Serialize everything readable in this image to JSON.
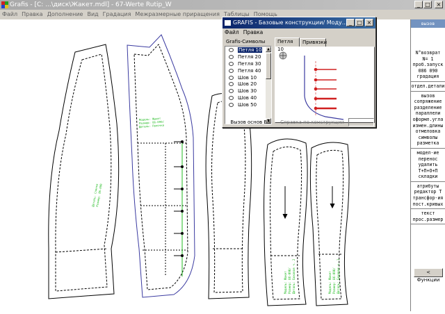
{
  "window": {
    "title": "Grafis - [C: ...\\диск\\Жакет.mdl] - 67-Werte Rutip_W",
    "minimize": "_",
    "maximize": "□",
    "close": "×"
  },
  "menubar": {
    "items": [
      "Файл",
      "Правка",
      "Дополнение",
      "Вид",
      "Градация",
      "Межразмерные приращения",
      "Таблицы",
      "Помощь"
    ]
  },
  "right_panel": {
    "header": "вызов",
    "groups": [
      [
        "N°возврат",
        "N=  1",
        "проб.запуск",
        "086 090",
        "градация"
      ],
      [
        "отдел.детали"
      ],
      [
        "вызов",
        "сопряжение",
        "разделение",
        "параллели",
        "оформл.угла",
        "измен.длины",
        "отмеловка",
        "символы",
        "разметка"
      ],
      [
        "модел-ие",
        "перенос",
        "удалить",
        "Т+П+О+П",
        "складки"
      ],
      [
        "атрибуты",
        "редактор Т",
        "трансфор-ия",
        "пост.кривых"
      ],
      [
        "текст",
        "прос.размер"
      ]
    ],
    "functions_button": "< Функции"
  },
  "dialog": {
    "title": "GRAFIS - Базовые конструкции/ Моду...",
    "menu": [
      "Файл",
      "Правка"
    ],
    "list_header": "Grafis-Символы",
    "list_items": [
      "Петля 10",
      "Петля 20",
      "Петля 30",
      "Петля 40",
      "Шов 10",
      "Шов 20",
      "Шов 30",
      "Шов 40",
      "Шов 50"
    ],
    "selected_index": 0,
    "tabs": [
      "Петля 10",
      "Привязки"
    ],
    "active_tab": "Петля 10",
    "status_left": "Вызов основ В8",
    "status_right": "Справка по конструкции"
  },
  "pattern_labels": {
    "piece_2": [
      "Модель: Жакет",
      "Размер: 86-090/",
      "Деталь: Полочка"
    ],
    "piece_4": [
      "Модель: Жакет",
      "Размер: 86-090/",
      "Деталь: Боковая ч. 2"
    ],
    "piece_5": [
      "Модель: Жакет",
      "Размер: 86-090/",
      "Деталь: Боковая ч. 1"
    ],
    "piece_1": [
      "Деталь: Спинка",
      "Размер: 86-090"
    ]
  },
  "colors": {
    "titlebar_inactive": "#b4b4b4",
    "dialog_titlebar": "#0a246a",
    "right_panel_header": "#7393c0",
    "pattern_label": "#22bb22",
    "front_piece": "#3a3aa0",
    "button_marker": "#d02020"
  }
}
